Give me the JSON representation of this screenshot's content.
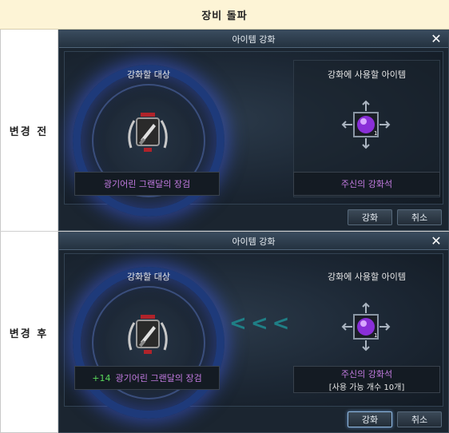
{
  "header": {
    "title": "장비 돌파"
  },
  "rows": [
    {
      "label": "변경 전",
      "dialog": {
        "title": "아이템 강화",
        "target_label": "강화할 대상",
        "use_label": "강화에 사용할 아이템",
        "target_name": "광기어린 그랜달의 장검",
        "use_name": "주신의 강화석",
        "confirm": "강화",
        "cancel": "취소"
      }
    },
    {
      "label": "변경 후",
      "dialog": {
        "title": "아이템 강화",
        "target_label": "강화할 대상",
        "use_label": "강화에 사용할 아이템",
        "target_plus": "+14",
        "target_name": "광기어린 그랜달의 장검",
        "use_name": "주신의 강화석",
        "use_count": "[사용 가능 개수 10개]",
        "arrows": "< < <",
        "confirm": "강화",
        "cancel": "취소"
      }
    }
  ],
  "colors": {
    "accent_purple": "#c27ae0",
    "plus_green": "#59d95a",
    "arrow_teal": "#1f7f86"
  },
  "icons": [
    "sword-icon",
    "gem-icon",
    "close-icon"
  ]
}
